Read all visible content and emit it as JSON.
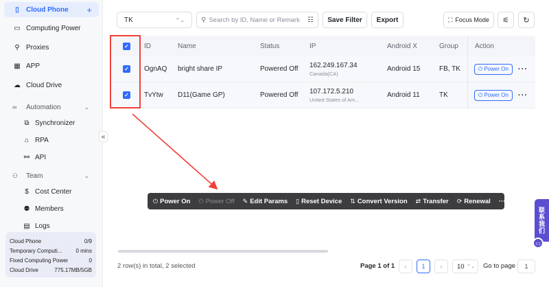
{
  "sidebar": {
    "cloud_phone": "Cloud Phone",
    "computing_power": "Computing Power",
    "proxies": "Proxies",
    "app": "APP",
    "cloud_drive": "Cloud Drive",
    "automation": "Automation",
    "synchronizer": "Synchronizer",
    "rpa": "RPA",
    "api": "API",
    "team": "Team",
    "cost_center": "Cost Center",
    "members": "Members",
    "logs": "Logs"
  },
  "usage": [
    {
      "label": "Cloud Phone",
      "value": "0/9"
    },
    {
      "label": "Temporary Computi...",
      "value": "0 mins"
    },
    {
      "label": "Fixed Computing Power",
      "value": "0"
    },
    {
      "label": "Cloud Drive",
      "value": "775.17MB/5GB"
    }
  ],
  "toolbar": {
    "group_select": "TK",
    "search_placeholder": "Search by ID, Name or Remark",
    "save_filter": "Save Filter",
    "export": "Export",
    "focus_mode": "Focus Mode"
  },
  "table": {
    "headers": {
      "id": "ID",
      "name": "Name",
      "status": "Status",
      "ip": "IP",
      "android": "Android X",
      "group": "Group",
      "action": "Action"
    },
    "rows": [
      {
        "id": "OgnAQ",
        "name": "bright share IP",
        "status": "Powered Off",
        "ip": "162.249.167.34",
        "location": "Canada(CA)",
        "android": "Android 15",
        "group": "FB, TK",
        "action": "Power On"
      },
      {
        "id": "TvYtw",
        "name": "D11(Game GP)",
        "status": "Powered Off",
        "ip": "107.172.5.210",
        "location": "United States of Am...",
        "android": "Android 11",
        "group": "TK",
        "action": "Power On"
      }
    ]
  },
  "action_bar": {
    "power_on": "Power On",
    "power_off": "Power Off",
    "edit_params": "Edit Params",
    "reset_device": "Reset Device",
    "convert_version": "Convert Version",
    "transfer": "Transfer",
    "renewal": "Renewal",
    "more": "···"
  },
  "footer": {
    "summary": "2 row(s) in total, 2 selected",
    "page_info": "Page 1 of 1",
    "current_page": "1",
    "page_size": "10",
    "goto_label": "Go to page",
    "goto_value": "1"
  },
  "contact": {
    "label_1": "联",
    "label_2": "系",
    "label_3": "我",
    "label_4": "们"
  },
  "colors": {
    "accent": "#2f6bff",
    "highlight": "#f04037",
    "action_bar": "#3d3d3f",
    "contact": "#5b4ed0"
  }
}
